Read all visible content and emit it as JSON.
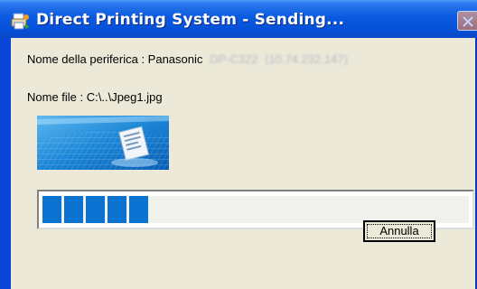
{
  "window": {
    "title": "Direct Printing System - Sending..."
  },
  "device": {
    "label": "Nome della periferica : Panasonic",
    "model_blurred": "DP-C322",
    "address_blurred": "(10.74.232.147)"
  },
  "file": {
    "label": "Nome file : C:\\..\\Jpeg1.jpg"
  },
  "progress": {
    "chunks_filled": 5,
    "chunks_total": 22,
    "fraction": 0.23,
    "color": "#0a73d2"
  },
  "buttons": {
    "cancel": "Annulla"
  },
  "icons": {
    "app": "printer-app-icon",
    "close": "close-icon",
    "banner": "printing-document-image"
  }
}
